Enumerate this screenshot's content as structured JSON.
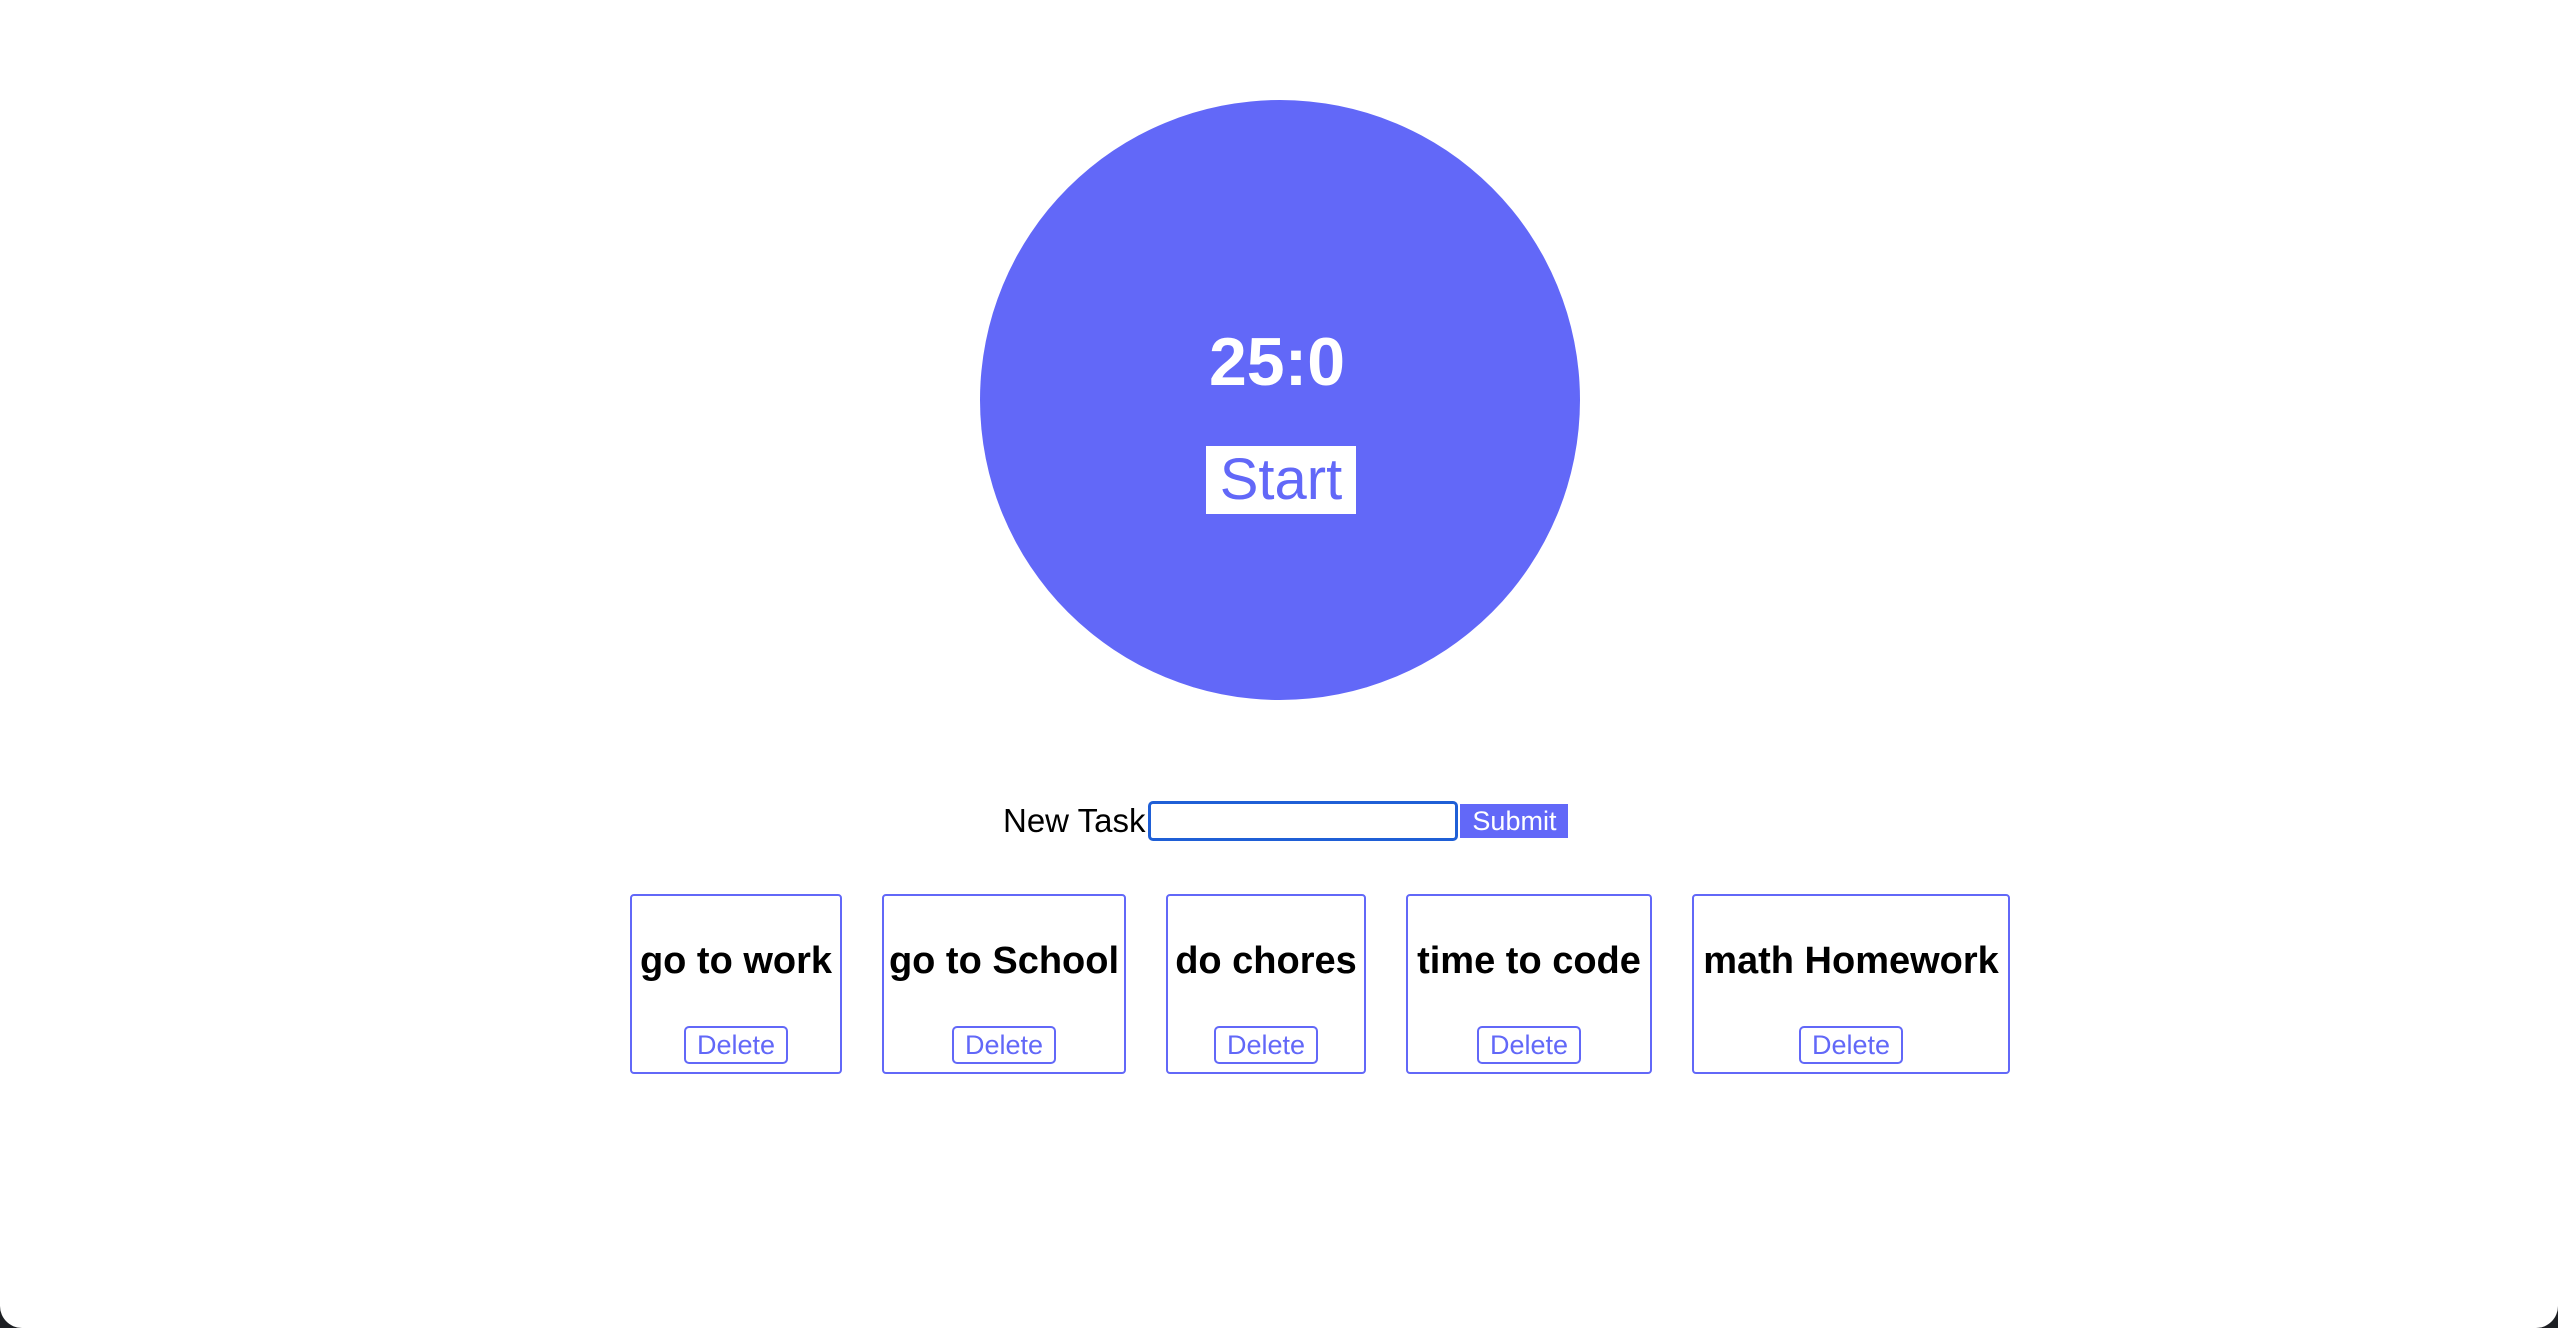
{
  "timer": {
    "display": "25:0",
    "start_label": "Start"
  },
  "task_form": {
    "label": "New Task",
    "input_value": "",
    "placeholder": "",
    "submit_label": "Submit"
  },
  "tasks": [
    {
      "title": "go to work",
      "delete_label": "Delete"
    },
    {
      "title": "go to School",
      "delete_label": "Delete"
    },
    {
      "title": "do chores",
      "delete_label": "Delete"
    },
    {
      "title": "time to code",
      "delete_label": "Delete"
    },
    {
      "title": "math Homework",
      "delete_label": "Delete"
    }
  ],
  "colors": {
    "accent": "#6268f8",
    "background": "#ffffff",
    "focus_ring": "#1f5fd6"
  }
}
